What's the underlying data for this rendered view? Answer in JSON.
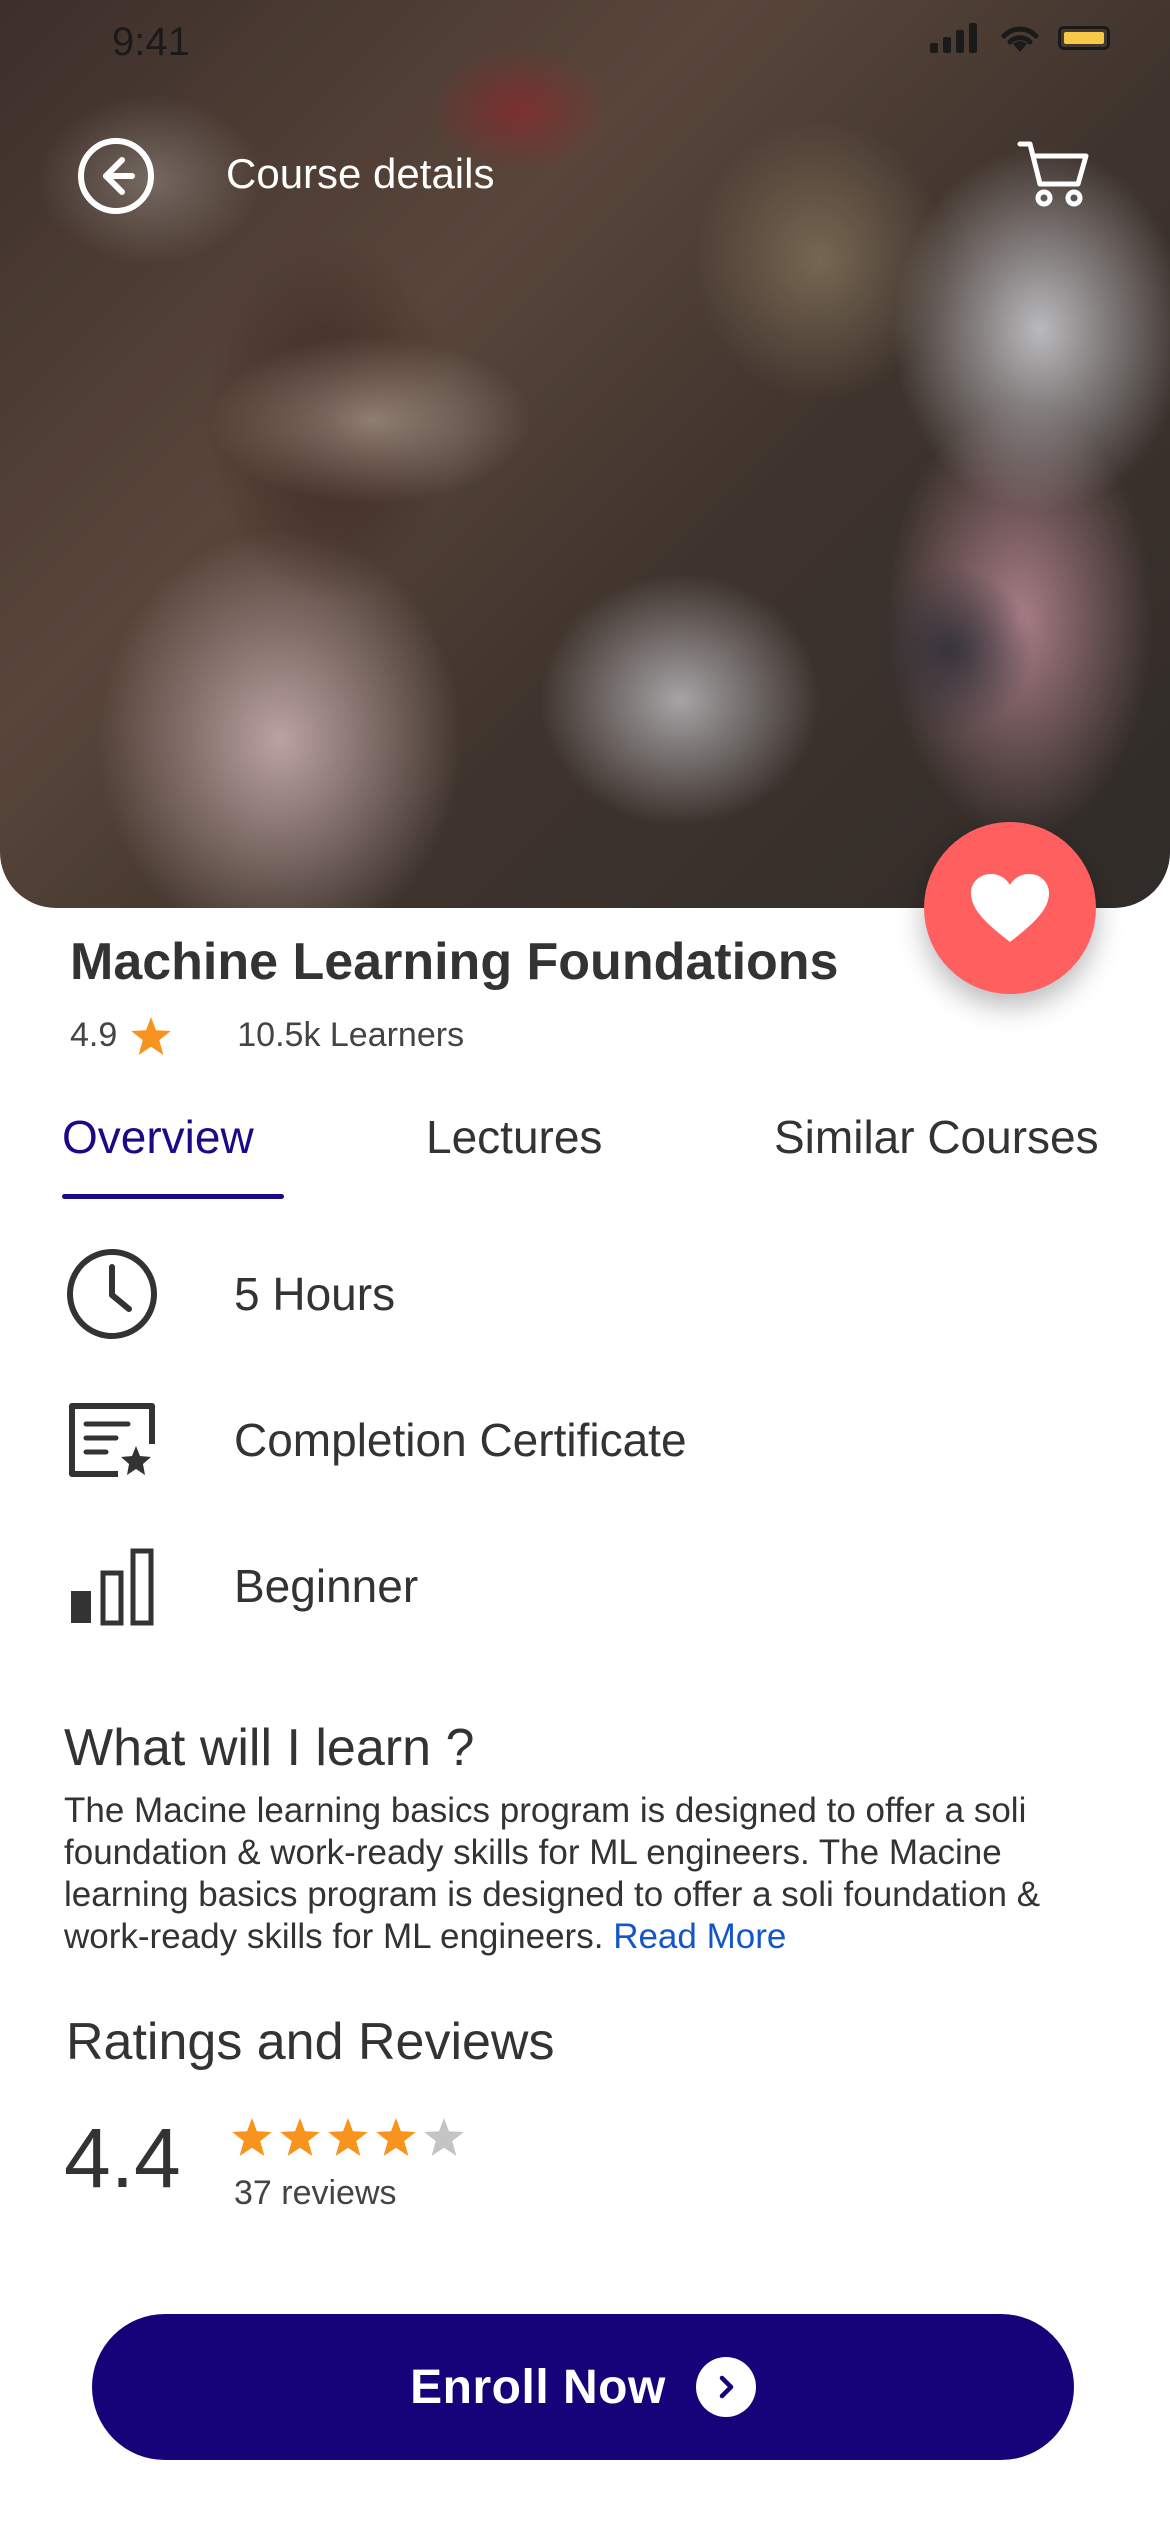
{
  "status_bar": {
    "time": "9:41"
  },
  "header": {
    "title": "Course details",
    "back_icon": "arrow-left-circle-icon",
    "cart_icon": "cart-icon"
  },
  "hero": {
    "favorite_icon": "heart-icon"
  },
  "course": {
    "title": "Machine Learning Foundations",
    "rating": "4.9",
    "learners": "10.5k Learners"
  },
  "tabs": [
    {
      "label": "Overview",
      "active": true
    },
    {
      "label": "Lectures",
      "active": false
    },
    {
      "label": "Similar Courses",
      "active": false
    }
  ],
  "features": [
    {
      "icon": "clock-icon",
      "label": "5 Hours"
    },
    {
      "icon": "certificate-icon",
      "label": "Completion Certificate"
    },
    {
      "icon": "level-bars-icon",
      "label": "Beginner"
    }
  ],
  "learn": {
    "title": "What will I learn ?",
    "description": "The Macine learning basics program is designed to offer a soli foundation & work-ready skills for ML engineers. The Macine learning basics program is designed to offer a soli foundation & work-ready skills for ML engineers.",
    "read_more": "Read More"
  },
  "reviews": {
    "title": "Ratings and Reviews",
    "average": "4.4",
    "stars_filled": 4,
    "stars_total": 5,
    "count_label": "37 reviews"
  },
  "cta": {
    "label": "Enroll Now"
  },
  "colors": {
    "primary": "#16037a",
    "accent_tab": "#1a0a86",
    "favorite": "#ff5f5f",
    "star": "#f7941d",
    "star_empty": "#c4c4c4",
    "link": "#1455c9"
  }
}
